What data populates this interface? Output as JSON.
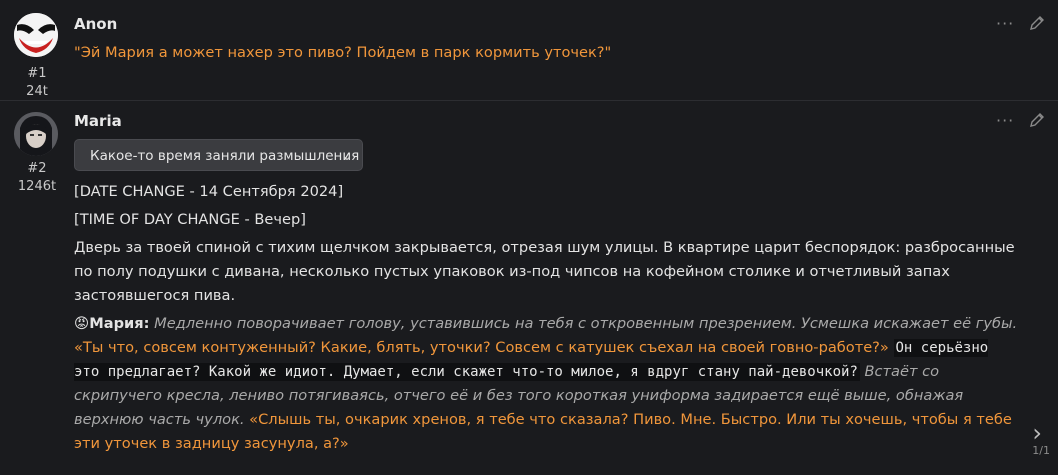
{
  "messages": [
    {
      "author": "Anon",
      "index": "#1",
      "tokens": "24t",
      "text": "\"Эй Мария а может нахер это пиво? Пойдем в парк кормить уточек?\""
    },
    {
      "author": "Maria",
      "index": "#2",
      "tokens": "1246t",
      "thinking_label": "Какое-то время заняли размышления",
      "date_change": "[DATE CHANGE - 14 Сентября 2024]",
      "time_change": "[TIME OF DAY CHANGE - Вечер]",
      "narration": "Дверь за твоей спиной с тихим щелчком закрывается, отрезая шум улицы. В квартире царит беспорядок: разбросанные по полу подушки с дивана, несколько пустых упаковок из-под чипсов на кофейном столике и отчетливый запах застоявшегося пива.",
      "emoji": "😡",
      "speaker": "Мария:",
      "action1": "Медленно поворачивает голову, уставившись на тебя с откровенным презрением. Усмешка искажает её губы.",
      "speech1": "«Ты что, совсем контуженный? Какие, блять, уточки? Совсем с катушек съехал на своей говно-работе?»",
      "thought": "Он серьёзно это предлагает? Какой же идиот. Думает, если скажет что-то милое, я вдруг стану пай-девочкой?",
      "action2": "Встаёт со скрипучего кресла, лениво потягиваясь, отчего её и без того короткая униформа задирается ещё выше, обнажая верхнюю часть чулок.",
      "speech2": "«Слышь ты, очкарик хренов, я тебе что сказала? Пиво. Мне. Быстро. Или ты хочешь, чтобы я тебе эти уточек в задницу засунула, а?»"
    }
  ],
  "actions": {
    "more_icon": "more-dots-icon",
    "edit_icon": "pencil-icon"
  },
  "swipe": {
    "counter": "1/1"
  },
  "colors": {
    "background": "#1a1b1e",
    "quote": "#f0963b",
    "italic": "#a9a9a9"
  }
}
